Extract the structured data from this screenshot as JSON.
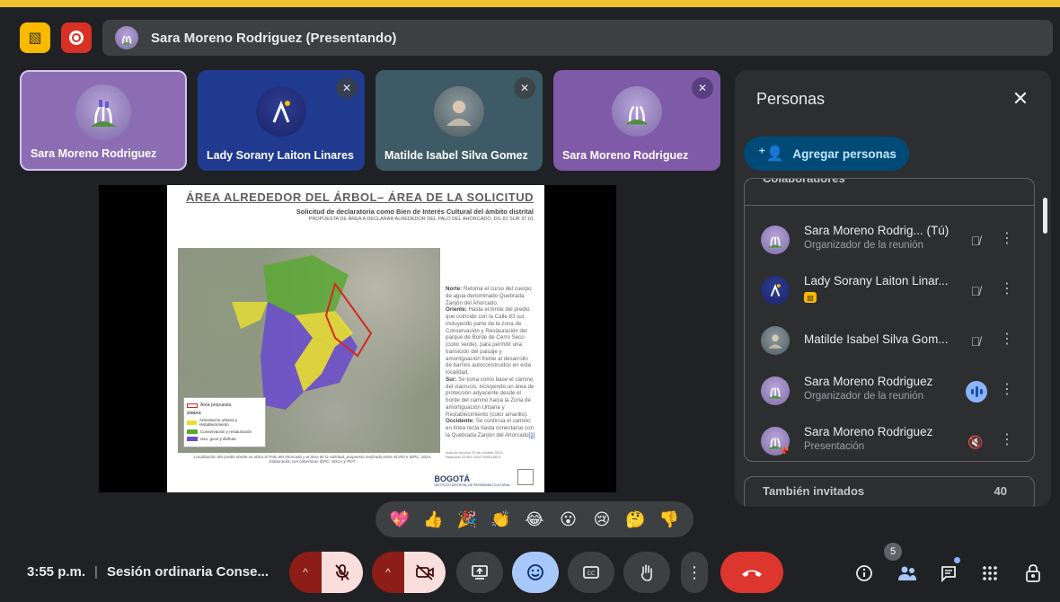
{
  "top": {
    "presenting_label": "Sara Moreno Rodriguez (Presentando)"
  },
  "tiles": [
    {
      "name": "Sara Moreno Rodriguez"
    },
    {
      "name": "Lady Sorany Laiton Linares"
    },
    {
      "name": "Matilde Isabel Silva Gomez"
    },
    {
      "name": "Sara Moreno Rodriguez"
    }
  ],
  "slide": {
    "title": "ÁREA ALREDEDOR DEL ÁRBOL– ÁREA DE LA SOLICITUD",
    "subtitle": "Solicitud de declaratoria como Bien de Interés Cultural del ámbito distrital",
    "subtitle2": "PROPUESTA DE ÁREA A DECLARAR ALREDEDOR DEL PALO DEL AHORCADO, DG 81 SUR 37 01",
    "legend_title": "Área propuesta",
    "legend_header": "ZONAS",
    "legend_items": [
      "Articulación urbana y restablecimiento",
      "Conservación y restauración",
      "Uso, goce y disfrute"
    ],
    "text_norte_label": "Norte:",
    "text_norte": " Retoma el curso del cuerpo de agua denominado Quebrada Zanjón del Ahorcado.",
    "text_oriente_label": "Oriente:",
    "text_oriente": " Hasta el límite del predio que coincide con la Calle 83 sur, incluyendo parte de la zona de Conservación y Restauración del parque de Borde de Cerro Seco (color verde), para permitir una transición del paisaje y amortiguación frente al desarrollo de barrios autoconstruidos en esta localidad.",
    "text_sur_label": "Sur:",
    "text_sur": " Se toma como base el camino del viacrucis, incluyendo un área de protección adyacente desde el borde del camino hacia la Zona de amortiguación Urbana y Restablecimiento (color amarillo).",
    "text_occ_label": "Occidente:",
    "text_occ": " Se continúa el camino en línea recta hasta conectarse con la Quebrada Zanjón del Ahorcado",
    "text_ref": "[1]",
    "caption": "Localización del predio donde se ubica el Palo del Ahorcado y el área de la solicitud, propuesta realizada entre SCRD e IDPC, 2024. Elaboración con coberturas IDPC, SDCA y POT.",
    "source": "Acta de reunión 23 de octubre 2024. Radicado SCRD 20247000519812",
    "logo": "BOGOTÁ",
    "logo_sub": "INSTITUTO DISTRITAL DE PATRIMONIO CULTURAL"
  },
  "panel": {
    "title": "Personas",
    "add_label": "Agregar personas",
    "section1": "Colaboradores",
    "people": [
      {
        "name": "Sara Moreno Rodrig... (Tú)",
        "role": "Organizador de la reunión"
      },
      {
        "name": "Lady Sorany Laiton Linar...",
        "role": ""
      },
      {
        "name": "Matilde Isabel Silva Gom...",
        "role": ""
      },
      {
        "name": "Sara Moreno Rodriguez",
        "role": "Organizador de la reunión"
      },
      {
        "name": "Sara Moreno Rodriguez",
        "role": "Presentación"
      }
    ],
    "section2": "También invitados",
    "section2_count": "40"
  },
  "reactions": [
    "💖",
    "👍",
    "🎉",
    "👏",
    "😂",
    "😮",
    "😢",
    "🤔",
    "👎"
  ],
  "bottom": {
    "time": "3:55 p.m.",
    "meeting_title": "Sesión ordinaria Conse...",
    "people_count": "5"
  }
}
